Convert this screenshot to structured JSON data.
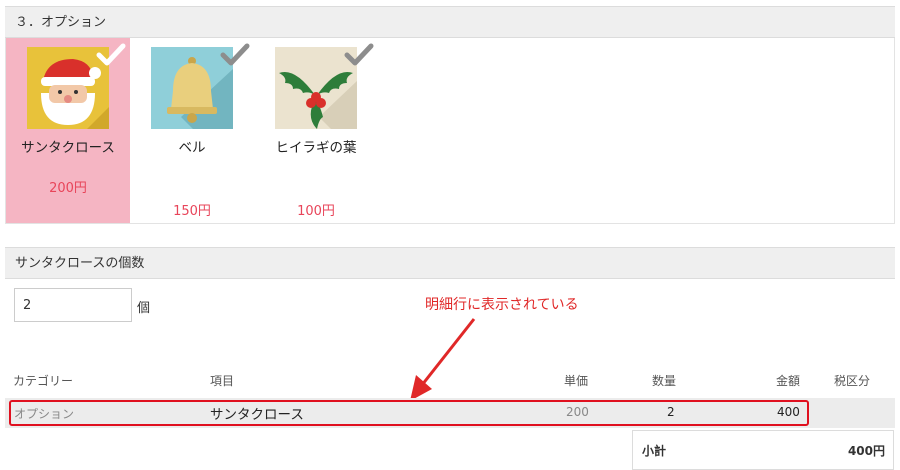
{
  "options_section": {
    "title": "３．オプション",
    "items": [
      {
        "name": "サンタクロース",
        "price": "200円",
        "icon": "santa-icon",
        "selected": true
      },
      {
        "name": "ベル",
        "price": "150円",
        "icon": "bell-icon",
        "selected": false
      },
      {
        "name": "ヒイラギの葉",
        "price": "100円",
        "icon": "holly-icon",
        "selected": false
      }
    ]
  },
  "quantity_section": {
    "title": "サンタクロースの個数",
    "value": "2",
    "unit": "個"
  },
  "annotation": {
    "text": "明細行に表示されている",
    "color": "#e02828"
  },
  "details_table": {
    "headers": [
      "カテゴリー",
      "項目",
      "単価",
      "数量",
      "金額",
      "税区分"
    ],
    "row": {
      "category": "オプション",
      "item": "サンタクロース",
      "unit_price": "200",
      "quantity": "2",
      "amount": "400",
      "tax": ""
    },
    "subtotal_label": "小計",
    "subtotal_value": "400円"
  },
  "colors": {
    "selected_bg": "#f5b5c3",
    "price": "#e8455a",
    "highlight_border": "#e0101f"
  }
}
